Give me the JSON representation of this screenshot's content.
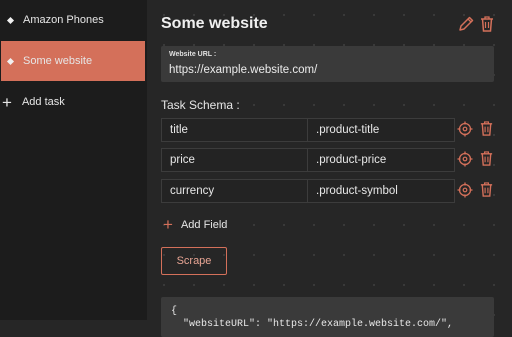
{
  "sidebar": {
    "items": [
      {
        "label": "Amazon Phones"
      },
      {
        "label": "Some website"
      }
    ],
    "add_task_label": "Add task"
  },
  "main": {
    "title": "Some website",
    "url_label": "Website URL :",
    "url_value": "https://example.website.com/",
    "schema_label": "Task Schema :",
    "schema_rows": [
      {
        "name": "title",
        "selector": ".product-title"
      },
      {
        "name": "price",
        "selector": ".product-price"
      },
      {
        "name": "currency",
        "selector": ".product-symbol"
      }
    ],
    "add_field_label": "Add Field",
    "scrape_label": "Scrape",
    "output_text": "{\n  \"websiteURL\": \"https://example.website.com/\","
  },
  "colors": {
    "accent": "#d4705a",
    "background": "#262626",
    "sidebar": "#1c1c1c"
  },
  "icons": [
    "pencil-icon",
    "trash-icon",
    "crosshair-icon",
    "plus-icon"
  ]
}
